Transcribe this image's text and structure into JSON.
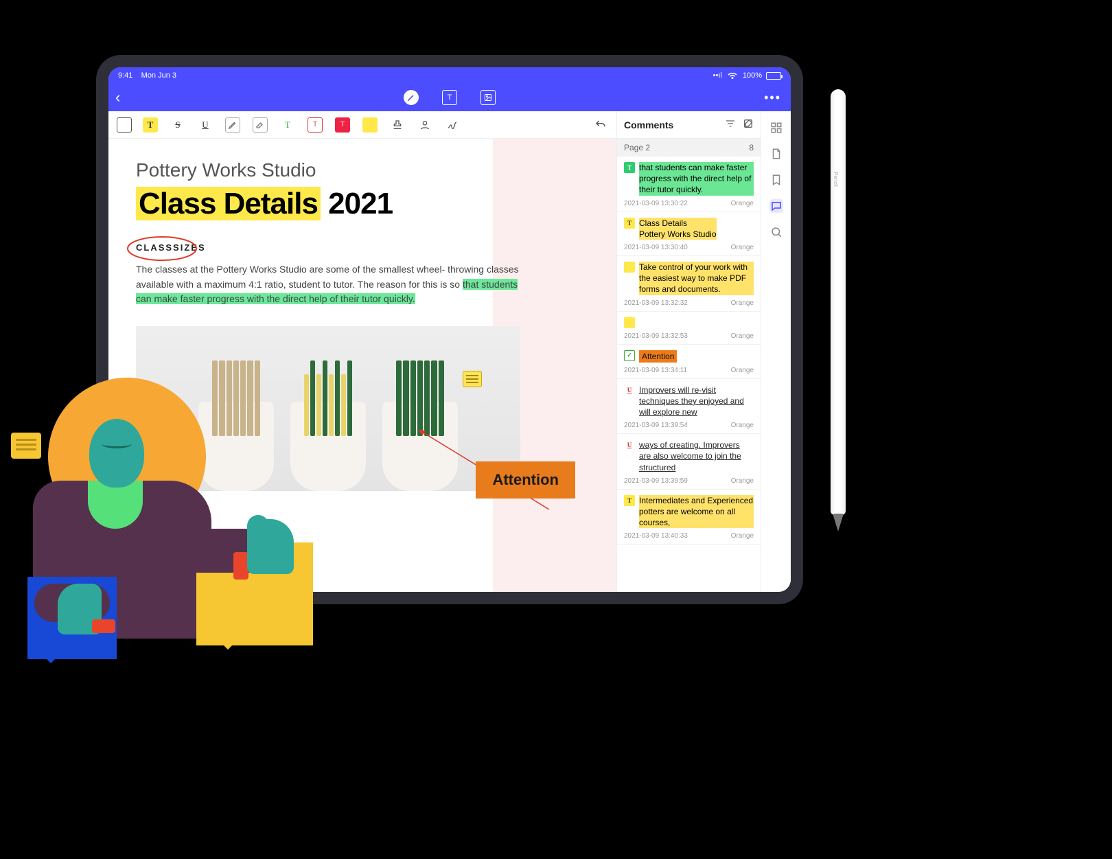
{
  "statusbar": {
    "time": "9:41",
    "date": "Mon Jun 3",
    "battery": "100%"
  },
  "document": {
    "studio": "Pottery Works Studio",
    "heading_hl": "Class Details",
    "heading_rest": "2021",
    "section_label": "CLASSSIZES",
    "para_pre": "The classes at the Pottery Works Studio are some of the smallest wheel- throwing classes available with a maximum 4:1 ratio, student to tutor. The reason for this is so ",
    "para_hl": "that students can make faster progress with the direct help of their tutor quickly.",
    "attention_label": "Attention"
  },
  "comments": {
    "title": "Comments",
    "page_label": "Page 2",
    "page_count": "8",
    "items": [
      {
        "icon": "hl-green-box",
        "glyph": "T",
        "style": "green-hl",
        "text": "that students can make faster progress with the direct help of their tutor quickly.",
        "time": "2021-03-09 13:30:22",
        "author": "Orange"
      },
      {
        "icon": "hl-yellow-box",
        "glyph": "T",
        "style": "yellow-hl",
        "text": "Class Details\nPottery Works Studio",
        "time": "2021-03-09 13:30:40",
        "author": "Orange"
      },
      {
        "icon": "note-box",
        "glyph": "",
        "style": "yellow-hl",
        "text": "Take control of your work with the easiest way to make PDF forms and documents.",
        "time": "2021-03-09 13:32:32",
        "author": "Orange"
      },
      {
        "icon": "note-box",
        "glyph": "",
        "style": "",
        "text": "",
        "time": "2021-03-09 13:32:53",
        "author": "Orange"
      },
      {
        "icon": "stamp-box",
        "glyph": "✓",
        "style": "orange-hl",
        "text": "Attention",
        "time": "2021-03-09 13:34:11",
        "author": "Orange"
      },
      {
        "icon": "ul-box",
        "glyph": "U",
        "style": "underline",
        "text": "Improvers will re-visit techniques they enjoyed and will explore new",
        "time": "2021-03-09 13:39:54",
        "author": "Orange"
      },
      {
        "icon": "ul-box",
        "glyph": "U",
        "style": "underline",
        "text": "ways of creating. Improvers are also welcome to join the structured",
        "time": "2021-03-09 13:39:59",
        "author": "Orange"
      },
      {
        "icon": "hl-yellow-box",
        "glyph": "T",
        "style": "yellow-hl",
        "text": "Intermediates and Experienced potters are welcome on all courses,",
        "time": "2021-03-09 13:40:33",
        "author": "Orange"
      }
    ]
  },
  "stylus_brand": "Pencil"
}
